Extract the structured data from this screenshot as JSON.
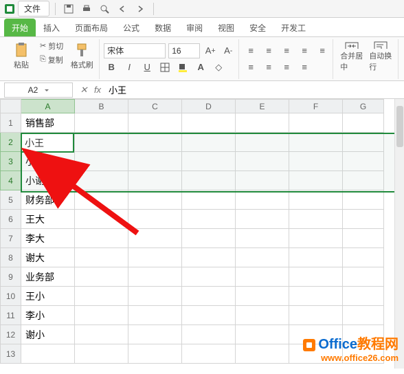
{
  "titlebar": {
    "file_label": "文件"
  },
  "tabs": {
    "items": [
      {
        "label": "开始",
        "active": true
      },
      {
        "label": "插入"
      },
      {
        "label": "页面布局"
      },
      {
        "label": "公式"
      },
      {
        "label": "数据"
      },
      {
        "label": "审阅"
      },
      {
        "label": "视图"
      },
      {
        "label": "安全"
      },
      {
        "label": "开发工"
      }
    ]
  },
  "ribbon": {
    "paste_label": "粘贴",
    "cut_label": "剪切",
    "copy_label": "复制",
    "format_painter_label": "格式刷",
    "font_name": "宋体",
    "font_size": "16",
    "merge_label": "合并居中",
    "wrap_label": "自动换行"
  },
  "fx": {
    "namebox": "A2",
    "value": "小王"
  },
  "grid": {
    "cols": [
      "A",
      "B",
      "C",
      "D",
      "E",
      "F",
      "G"
    ],
    "selected_col": "A",
    "selected_rows": [
      2,
      3,
      4
    ],
    "rows": [
      {
        "n": 1,
        "a": "销售部",
        "bold": true
      },
      {
        "n": 2,
        "a": "小王"
      },
      {
        "n": 3,
        "a": "小李"
      },
      {
        "n": 4,
        "a": "小谢"
      },
      {
        "n": 5,
        "a": "财务部",
        "bold": true
      },
      {
        "n": 6,
        "a": "王大"
      },
      {
        "n": 7,
        "a": "李大"
      },
      {
        "n": 8,
        "a": "谢大"
      },
      {
        "n": 9,
        "a": "业务部",
        "bold": true
      },
      {
        "n": 10,
        "a": "王小"
      },
      {
        "n": 11,
        "a": "李小"
      },
      {
        "n": 12,
        "a": "谢小"
      },
      {
        "n": 13,
        "a": ""
      }
    ]
  },
  "watermark": {
    "brand1": "Office",
    "brand2": "教程网",
    "url": "www.office26.com"
  }
}
